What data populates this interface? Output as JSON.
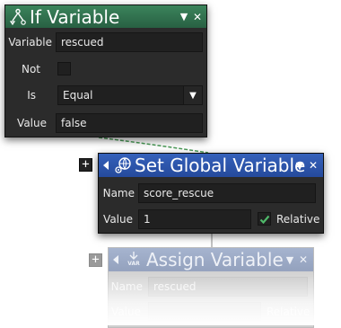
{
  "if_variable": {
    "title": "If Variable",
    "icon": "branch-icon",
    "labels": {
      "variable": "Variable",
      "not": "Not",
      "is": "Is",
      "value": "Value"
    },
    "variable_value": "rescued",
    "not_checked": false,
    "is_value": "Equal",
    "value_value": "false",
    "accent": "#2f6b48"
  },
  "set_global_variable": {
    "title": "Set Global Variable",
    "icon": "globe-gear-icon",
    "labels": {
      "name": "Name",
      "value": "Value",
      "relative": "Relative"
    },
    "name_value": "score_rescue",
    "value_value": "1",
    "relative_checked": true,
    "expand_symbol": "+",
    "accent": "#2a4fa2"
  },
  "assign_variable": {
    "title": "Assign Variable",
    "icon": "var-arrow-icon",
    "icon_text": "VAR",
    "labels": {
      "name": "Name",
      "value": "Value",
      "relative": "Relative"
    },
    "name_value": "rescued",
    "expand_symbol": "+",
    "accent": "#9aa7c2"
  },
  "connector_color": "#4a9a57"
}
